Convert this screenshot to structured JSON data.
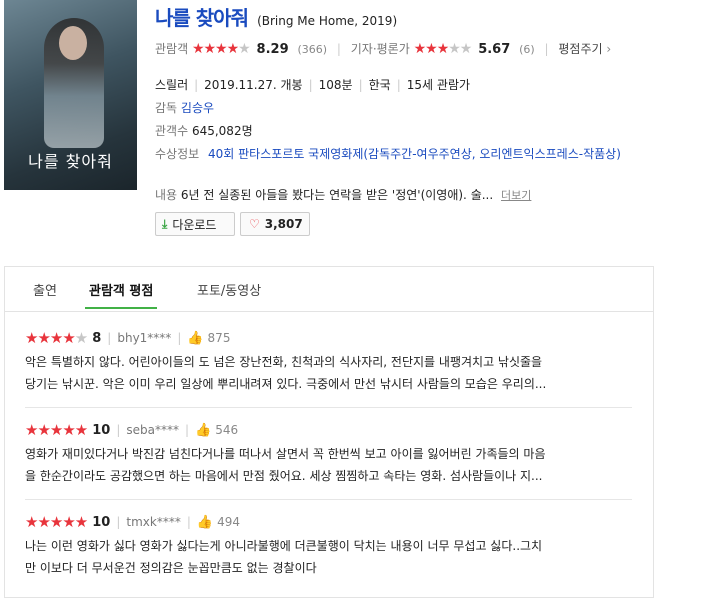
{
  "movie": {
    "title": "나를 찾아줘",
    "original": "(Bring Me Home, 2019)",
    "poster_title": "나를 찾아줘",
    "audience": {
      "label": "관람객",
      "stars": 4,
      "score": "8.29",
      "count": "(366)"
    },
    "critic": {
      "label": "기자·평론가",
      "stars": 3,
      "score": "5.67",
      "count": "(6)"
    },
    "rate_link": "평점주기",
    "genre": "스릴러",
    "release": "2019.11.27. 개봉",
    "runtime": "108분",
    "country": "한국",
    "age": "15세 관람가",
    "director_label": "감독",
    "director": "김승우",
    "viewers_label": "관객수",
    "viewers": "645,082명",
    "award_label": "수상정보",
    "award": "40회 판타스포르토 국제영화제(감독주간-여우주연상, 오리엔트익스프레스-작품상)",
    "plot_label": "내용",
    "plot": "6년 전 실종된 아들을 봤다는 연락을 받은 '정연'(이영애). 술...",
    "more": "더보기",
    "download": "다운로드",
    "likes": "3,807"
  },
  "tabs": [
    "출연",
    "관람객 평점",
    "포토/동영상"
  ],
  "reviews": [
    {
      "stars": 4,
      "score": "8",
      "user": "bhy1****",
      "likes": "875",
      "lines": [
        "악은 특별하지 않다. 어린아이들의 도 넘은 장난전화, 친척과의 식사자리, 전단지를 내팽겨치고 낚싯줄을",
        "당기는 낚시꾼. 악은 이미 우리 일상에 뿌리내려져 있다. 극중에서 만선 낚시터 사람들의 모습은 우리의..."
      ]
    },
    {
      "stars": 5,
      "score": "10",
      "user": "seba****",
      "likes": "546",
      "lines": [
        "영화가 재미있다거나 박진감 넘친다거나를 떠나서 살면서 꼭 한번씩 보고 아이를 잃어버린 가족들의 마음",
        "을 한순간이라도 공감했으면 하는 마음에서 만점 줬어요. 세상 찜찜하고 속타는 영화. 섬사람들이나 지..."
      ]
    },
    {
      "stars": 5,
      "score": "10",
      "user": "tmxk****",
      "likes": "494",
      "lines": [
        "나는 이런 영화가 싫다 영화가 싫다는게 아니라불행에 더큰불행이 닥치는 내용이 너무 무섭고 싫다..그치",
        "만 이보다 더 무서운건 정의감은 눈꼽만큼도 없는 경찰이다"
      ]
    }
  ]
}
